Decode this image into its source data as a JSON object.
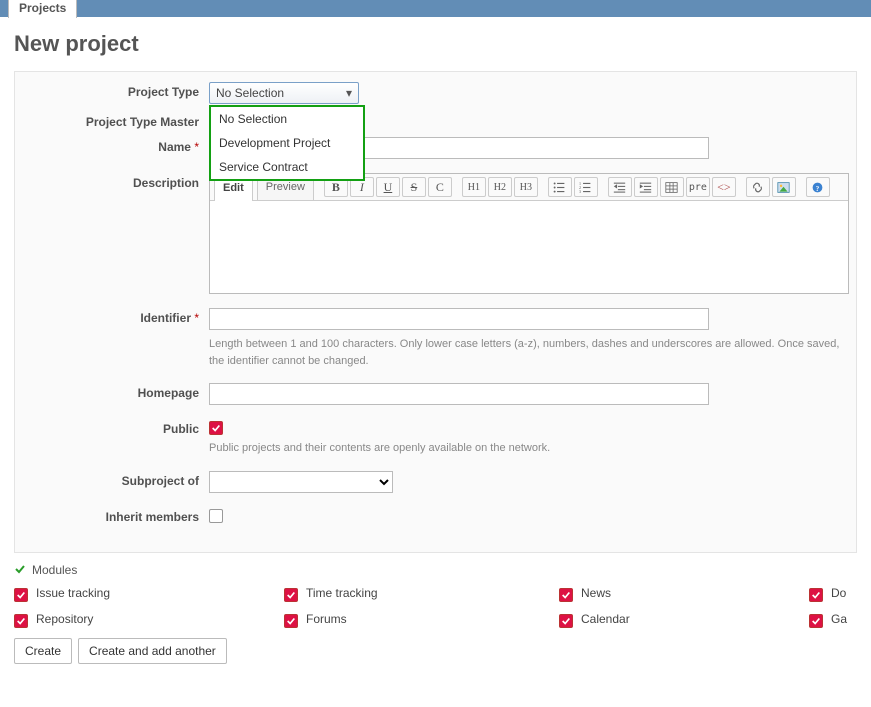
{
  "tab_label": "Projects",
  "page_title": "New project",
  "form": {
    "project_type": {
      "label": "Project Type",
      "selected": "No Selection",
      "options": [
        "No Selection",
        "Development Project",
        "Service Contract"
      ]
    },
    "project_type_master": {
      "label": "Project Type Master"
    },
    "name": {
      "label": "Name"
    },
    "description": {
      "label": "Description",
      "tabs": {
        "edit": "Edit",
        "preview": "Preview"
      }
    },
    "identifier": {
      "label": "Identifier",
      "hint": "Length between 1 and 100 characters. Only lower case letters (a-z), numbers, dashes and underscores are allowed. Once saved, the identifier cannot be changed."
    },
    "homepage": {
      "label": "Homepage"
    },
    "public": {
      "label": "Public",
      "hint": "Public projects and their contents are openly available on the network."
    },
    "subproject": {
      "label": "Subproject of"
    },
    "inherit": {
      "label": "Inherit members"
    }
  },
  "modules": {
    "header": "Modules",
    "items": [
      [
        "Issue tracking",
        "Time tracking",
        "News",
        "Do"
      ],
      [
        "Repository",
        "Forums",
        "Calendar",
        "Ga"
      ]
    ]
  },
  "actions": {
    "create": "Create",
    "create_another": "Create and add another"
  },
  "toolbar_labels": {
    "bold": "B",
    "italic": "I",
    "underline": "U",
    "strike": "S",
    "code": "C",
    "h1": "H1",
    "h2": "H2",
    "h3": "H3",
    "pre": "pre"
  }
}
